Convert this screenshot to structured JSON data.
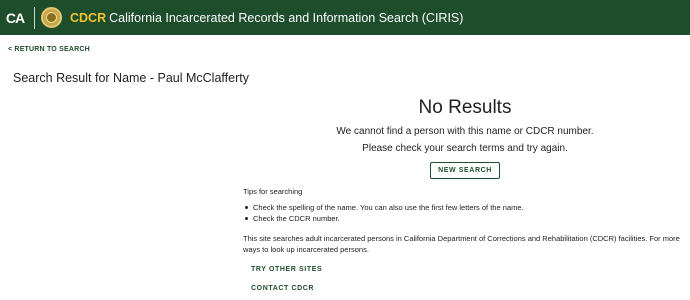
{
  "header": {
    "ca_logo_text": "CA",
    "brand": "CDCR",
    "title": "California Incarcerated Records and Information Search (CIRIS)",
    "seal_icon": "state-seal-icon",
    "colors": {
      "bar": "#1e4d2b",
      "brand": "#f2c230"
    }
  },
  "nav": {
    "return_label": "< RETURN TO SEARCH"
  },
  "result": {
    "heading": "Search Result for Name - Paul McClafferty",
    "no_results": "No Results",
    "message_line1": "We cannot find a person with this name or CDCR number.",
    "message_line2": "Please check your search terms and try again.",
    "new_search_label": "NEW SEARCH"
  },
  "tips": {
    "heading": "Tips for searching",
    "items": [
      "Check the spelling of the name. You can also use the first few letters of the name.",
      "Check the CDCR number."
    ],
    "info": "This site searches adult incarcerated persons in California Department of Corrections and Rehabilitation (CDCR) facilities. For more ways to look up incarcerated persons."
  },
  "links": {
    "try_other_sites": "TRY OTHER SITES",
    "contact_cdcr": "CONTACT CDCR"
  }
}
